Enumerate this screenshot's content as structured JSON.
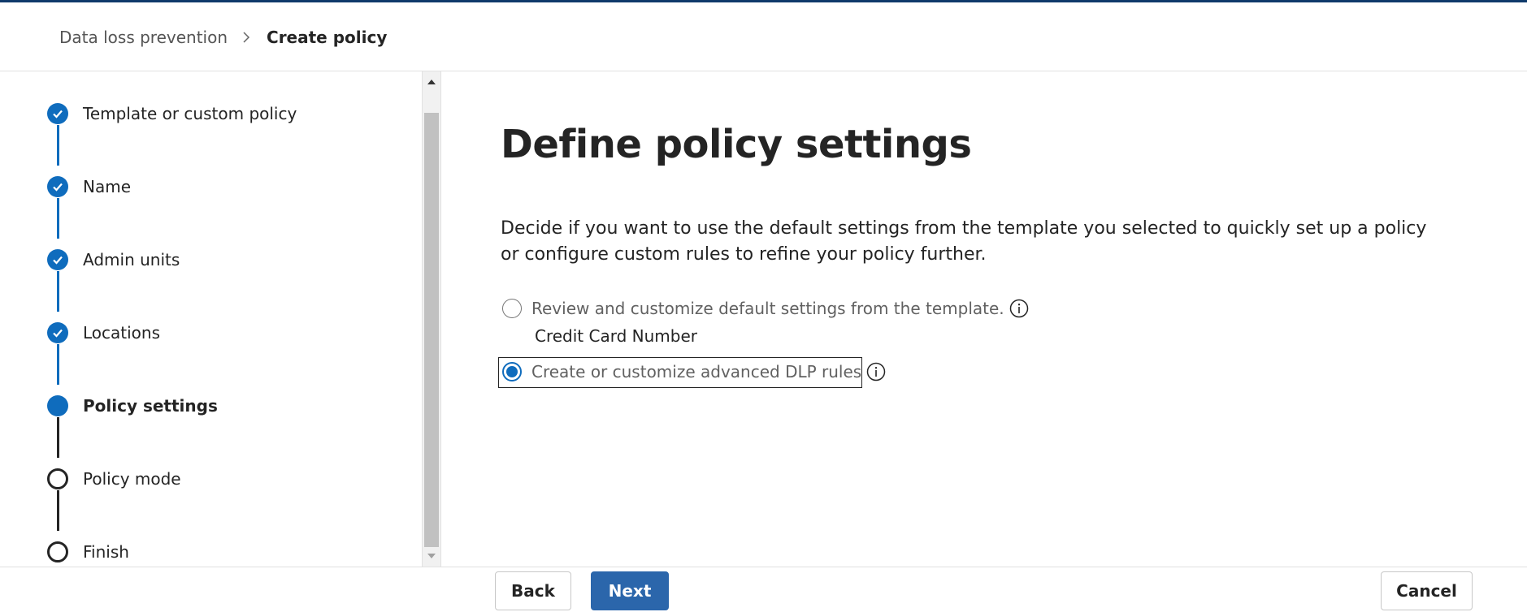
{
  "breadcrumb": {
    "parent": "Data loss prevention",
    "current": "Create policy"
  },
  "steps": [
    {
      "label": "Template or custom policy",
      "status": "completed"
    },
    {
      "label": "Name",
      "status": "completed"
    },
    {
      "label": "Admin units",
      "status": "completed"
    },
    {
      "label": "Locations",
      "status": "completed"
    },
    {
      "label": "Policy settings",
      "status": "current"
    },
    {
      "label": "Policy mode",
      "status": "not-started"
    },
    {
      "label": "Finish",
      "status": "not-started"
    }
  ],
  "main": {
    "title": "Define policy settings",
    "description": "Decide if you want to use the default settings from the template you selected to quickly set up a policy or configure custom rules to refine your policy further.",
    "options": [
      {
        "label": "Review and customize default settings from the template.",
        "checked": false,
        "sub_text": "Credit Card Number"
      },
      {
        "label": "Create or customize advanced DLP rules",
        "checked": true
      }
    ]
  },
  "footer": {
    "back_label": "Back",
    "next_label": "Next",
    "cancel_label": "Cancel"
  },
  "colors": {
    "accent": "#0f6cbd",
    "primary_button": "#2b66ab",
    "top_bar": "#0f3a6b"
  }
}
